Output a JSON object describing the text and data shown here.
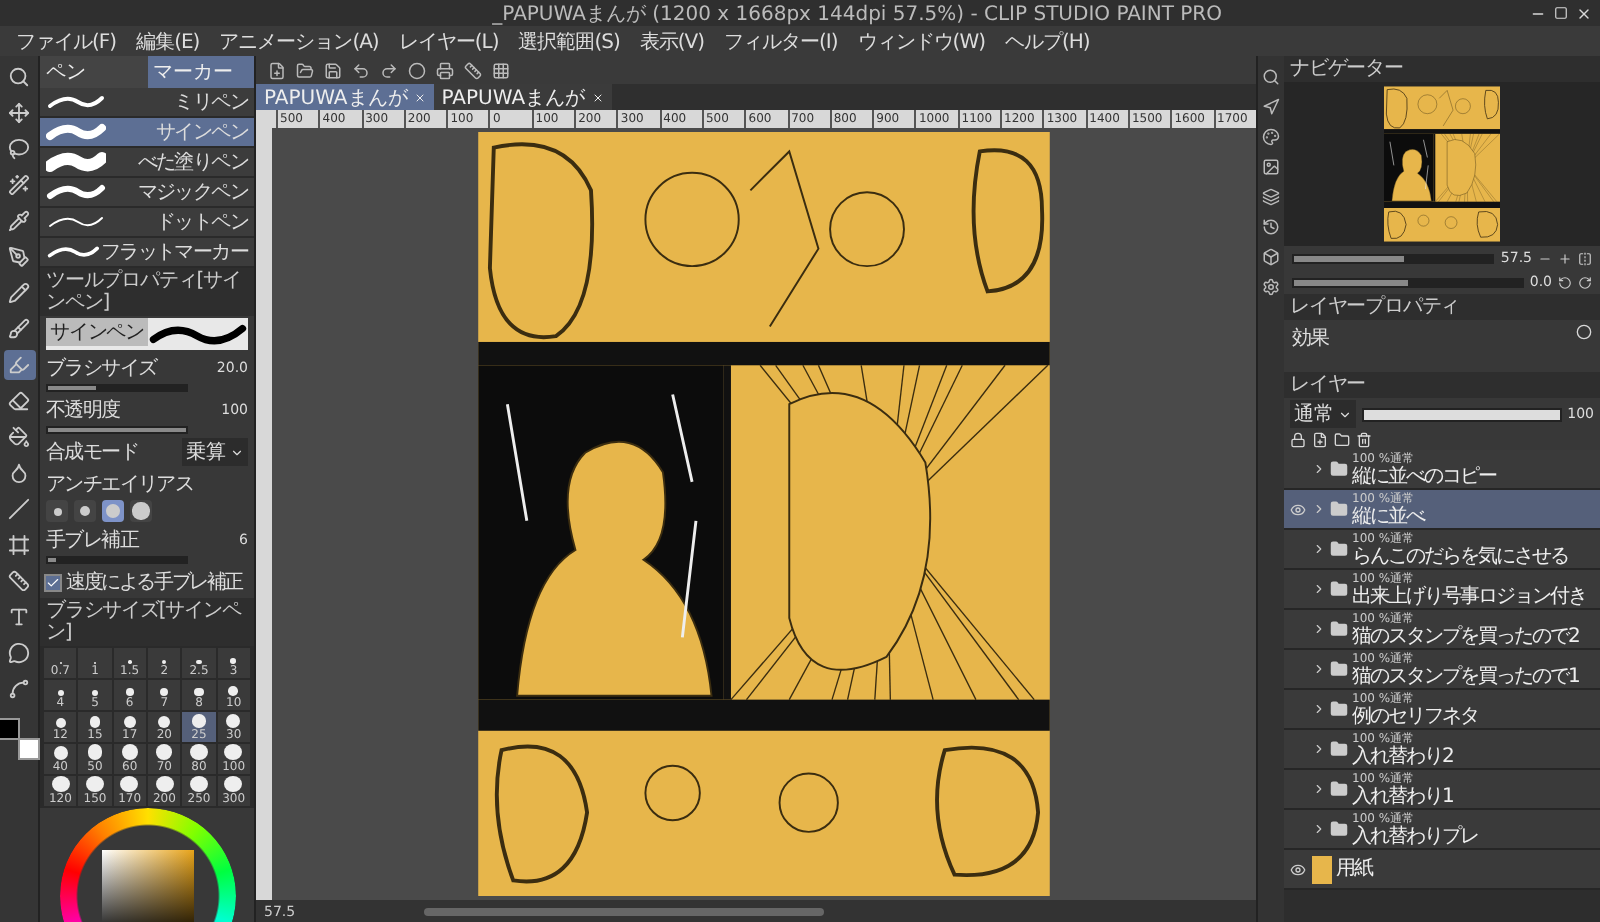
{
  "window": {
    "title": "_PAPUWAまんが (1200 x 1668px 144dpi 57.5%) - CLIP STUDIO PAINT PRO"
  },
  "menu": [
    "ファイル(F)",
    "編集(E)",
    "アニメーション(A)",
    "レイヤー(L)",
    "選択範囲(S)",
    "表示(V)",
    "フィルター(I)",
    "ウィンドウ(W)",
    "ヘルプ(H)"
  ],
  "tools": [
    {
      "kind": "zoom",
      "selected": false
    },
    {
      "kind": "move",
      "selected": false
    },
    {
      "kind": "lasso",
      "selected": false
    },
    {
      "kind": "wand",
      "selected": false
    },
    {
      "kind": "eyedropper",
      "selected": false
    },
    {
      "kind": "pen",
      "selected": false
    },
    {
      "kind": "pencil",
      "selected": false
    },
    {
      "kind": "brush",
      "selected": false
    },
    {
      "kind": "marker",
      "selected": true
    },
    {
      "kind": "eraser",
      "selected": false
    },
    {
      "kind": "fill",
      "selected": false
    },
    {
      "kind": "blend",
      "selected": false
    },
    {
      "kind": "line",
      "selected": false
    },
    {
      "kind": "frame",
      "selected": false
    },
    {
      "kind": "ruler",
      "selected": false
    },
    {
      "kind": "text",
      "selected": false
    },
    {
      "kind": "balloon",
      "selected": false
    },
    {
      "kind": "curve",
      "selected": false
    }
  ],
  "sub_tool": {
    "tabs": [
      {
        "label": "ペン",
        "selected": false
      },
      {
        "label": "マーカー",
        "selected": true
      }
    ],
    "items": [
      {
        "label": "ミリペン",
        "selected": false
      },
      {
        "label": "サインペン",
        "selected": true
      },
      {
        "label": "べた塗りペン",
        "selected": false
      },
      {
        "label": "マジックペン",
        "selected": false
      },
      {
        "label": "ドットペン",
        "selected": false
      },
      {
        "label": "フラットマーカー",
        "selected": false
      }
    ]
  },
  "tool_property": {
    "title": "ツールプロパティ[サインペン]",
    "preview_label": "サインペン",
    "rows": [
      {
        "kind": "slider",
        "label": "ブラシサイズ",
        "value": "20.0",
        "level": 0.35
      },
      {
        "kind": "slider",
        "label": "不透明度",
        "value": "100",
        "level": 1
      },
      {
        "kind": "select",
        "label": "合成モード",
        "value": "乗算"
      },
      {
        "kind": "antialias",
        "label": "アンチエイリアス",
        "levels": [
          {
            "selected": false
          },
          {
            "selected": false
          },
          {
            "selected": true
          },
          {
            "selected": false
          }
        ]
      },
      {
        "kind": "slider",
        "label": "手ブレ補正",
        "value": "6",
        "level": 0.06
      },
      {
        "kind": "checkbox",
        "label": "速度による手ブレ補正",
        "checked": true
      }
    ]
  },
  "brush_size": {
    "title": "ブラシサイズ[サインペン]",
    "sizes": [
      {
        "label": "0.7",
        "selected": false
      },
      {
        "label": "1",
        "selected": false
      },
      {
        "label": "1.5",
        "selected": false
      },
      {
        "label": "2",
        "selected": false
      },
      {
        "label": "2.5",
        "selected": false
      },
      {
        "label": "3",
        "selected": false
      },
      {
        "label": "4",
        "selected": false
      },
      {
        "label": "5",
        "selected": false
      },
      {
        "label": "6",
        "selected": false
      },
      {
        "label": "7",
        "selected": false
      },
      {
        "label": "8",
        "selected": false
      },
      {
        "label": "10",
        "selected": false
      },
      {
        "label": "12",
        "selected": false
      },
      {
        "label": "15",
        "selected": false
      },
      {
        "label": "17",
        "selected": false
      },
      {
        "label": "20",
        "selected": false
      },
      {
        "label": "25",
        "selected": true
      },
      {
        "label": "30",
        "selected": false
      },
      {
        "label": "40",
        "selected": false
      },
      {
        "label": "50",
        "selected": false
      },
      {
        "label": "60",
        "selected": false
      },
      {
        "label": "70",
        "selected": false
      },
      {
        "label": "80",
        "selected": false
      },
      {
        "label": "100",
        "selected": false
      },
      {
        "label": "120",
        "selected": false
      },
      {
        "label": "150",
        "selected": false
      },
      {
        "label": "170",
        "selected": false
      },
      {
        "label": "200",
        "selected": false
      },
      {
        "label": "250",
        "selected": false
      },
      {
        "label": "300",
        "selected": false
      }
    ]
  },
  "canvas": {
    "tabs": [
      {
        "label": "PAPUWAまんが",
        "selected": true
      },
      {
        "label": "PAPUWAまんが",
        "selected": false
      }
    ],
    "ruler": [
      "500",
      "400",
      "300",
      "200",
      "100",
      "0",
      "100",
      "200",
      "300",
      "400",
      "500",
      "600",
      "700",
      "800",
      "900",
      "1000",
      "1100",
      "1200",
      "1300",
      "1400",
      "1500",
      "1600",
      "1700"
    ],
    "zoom": "57.5"
  },
  "navigator": {
    "tab": "ナビゲーター",
    "zoom": "57.5",
    "zoom_slider": {
      "level": 0.55
    },
    "angle": "0.0",
    "angle_slider": {
      "level": 0.5
    }
  },
  "layer_property": {
    "tab": "レイヤープロパティ",
    "effect_label": "効果"
  },
  "layers": {
    "tab": "レイヤー",
    "blend": "通常",
    "opacity": "100",
    "opacity_slider": {
      "level": 1
    },
    "items": [
      {
        "kind": "folder",
        "mode": "100 %通常",
        "name": "縦に並べのコピー",
        "visible": false,
        "selected": false
      },
      {
        "kind": "folder",
        "mode": "100 %通常",
        "name": "縦に並べ",
        "visible": true,
        "selected": true
      },
      {
        "kind": "folder",
        "mode": "100 %通常",
        "name": "らんこのだらを気にさせる",
        "visible": false,
        "selected": false
      },
      {
        "kind": "folder",
        "mode": "100 %通常",
        "name": "出来上げり号事ロジョン付き",
        "visible": false,
        "selected": false
      },
      {
        "kind": "folder",
        "mode": "100 %通常",
        "name": "猫のスタンプを買ったので2",
        "visible": false,
        "selected": false
      },
      {
        "kind": "folder",
        "mode": "100 %通常",
        "name": "猫のスタンプを買ったので1",
        "visible": false,
        "selected": false
      },
      {
        "kind": "folder",
        "mode": "100 %通常",
        "name": "例のセリフネタ",
        "visible": false,
        "selected": false
      },
      {
        "kind": "folder",
        "mode": "100 %通常",
        "name": "入れ替わり2",
        "visible": false,
        "selected": false
      },
      {
        "kind": "folder",
        "mode": "100 %通常",
        "name": "入れ替わり1",
        "visible": false,
        "selected": false
      },
      {
        "kind": "folder",
        "mode": "100 %通常",
        "name": "入れ替わりプレ",
        "visible": false,
        "selected": false
      },
      {
        "kind": "paper",
        "name": "用紙",
        "visible": true,
        "selected": false
      }
    ]
  }
}
